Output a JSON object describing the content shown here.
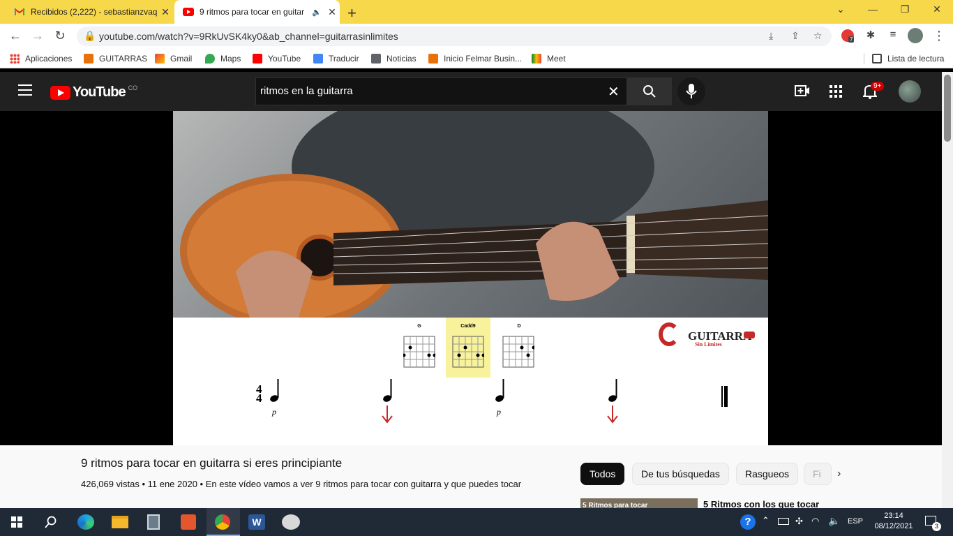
{
  "browser": {
    "tabs": [
      {
        "title": "Recibidos (2,222) - sebastianzvaq",
        "favicon": "gmail-icon"
      },
      {
        "title": "9 ritmos para tocar en guitar",
        "favicon": "youtube-icon",
        "audio": true
      }
    ],
    "url": "youtube.com/watch?v=9RkUvSK4ky0&ab_channel=guitarrasinlimites",
    "extension_badge": "7",
    "bookmarks": [
      "Aplicaciones",
      "GUITARRAS",
      "Gmail",
      "Maps",
      "YouTube",
      "Traducir",
      "Noticias",
      "Inicio Felmar Busin...",
      "Meet"
    ],
    "reading_list": "Lista de lectura"
  },
  "youtube": {
    "logo_text": "YouTube",
    "country_code": "CO",
    "search_value": "ritmos en la guitarra",
    "notification_count": "9+",
    "video": {
      "title": "9 ritmos para tocar en guitarra si eres principiante",
      "meta": "426,069 vistas • 11 ene 2020 • En este vídeo vamos a ver 9 ritmos para tocar con guitarra y que puedes tocar",
      "chords": [
        "G",
        "Cadd9",
        "D"
      ],
      "time_signature_top": "4",
      "time_signature_bottom": "4",
      "dynamic_mark": "p",
      "brand_main": "GUITARRA",
      "brand_sub": "Sin Límites"
    },
    "chips": [
      "Todos",
      "De tus búsquedas",
      "Rasgueos",
      "Fi"
    ],
    "related": {
      "title": "5 Ritmos con los que tocar",
      "thumb_text": "5 Ritmos para tocar"
    }
  },
  "taskbar": {
    "language": "ESP",
    "time": "23:14",
    "date": "08/12/2021",
    "notifications": "3"
  },
  "colors": {
    "chrome_frame": "#f7d84b",
    "yt_red": "#ff0000",
    "accent_red": "#c62828",
    "chord_highlight": "#f7f29b"
  }
}
